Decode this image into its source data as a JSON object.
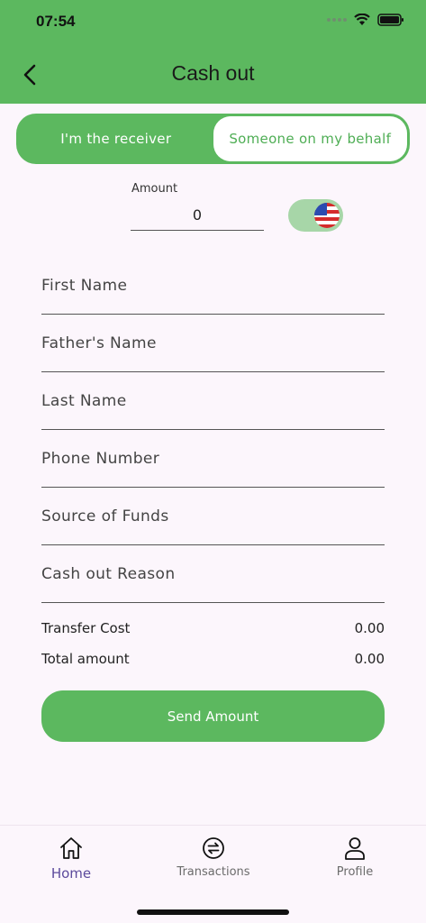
{
  "status_bar": {
    "time": "07:54"
  },
  "header": {
    "title": "Cash out"
  },
  "segment": {
    "left_label": "I'm the receiver",
    "right_label": "Someone on my behalf",
    "selected": "Someone on my behalf"
  },
  "amount": {
    "label": "Amount",
    "value": "0",
    "currency_flag": "us-flag-icon"
  },
  "fields": [
    {
      "label": "First Name"
    },
    {
      "label": "Father's Name"
    },
    {
      "label": "Last Name"
    },
    {
      "label": "Phone Number"
    },
    {
      "label": "Source of Funds"
    },
    {
      "label": "Cash out Reason"
    }
  ],
  "summary": {
    "transfer_cost_label": "Transfer Cost",
    "transfer_cost_value": "0.00",
    "total_label": "Total amount",
    "total_value": "0.00"
  },
  "send_button": {
    "label": "Send Amount"
  },
  "bottom_nav": [
    {
      "label": "Home",
      "icon": "home-icon",
      "active": true
    },
    {
      "label": "Transactions",
      "icon": "transactions-icon",
      "active": false
    },
    {
      "label": "Profile",
      "icon": "profile-icon",
      "active": false
    }
  ],
  "colors": {
    "primary": "#5cb85f",
    "background": "#fcf6fc",
    "active_nav": "#5c4a9c"
  }
}
